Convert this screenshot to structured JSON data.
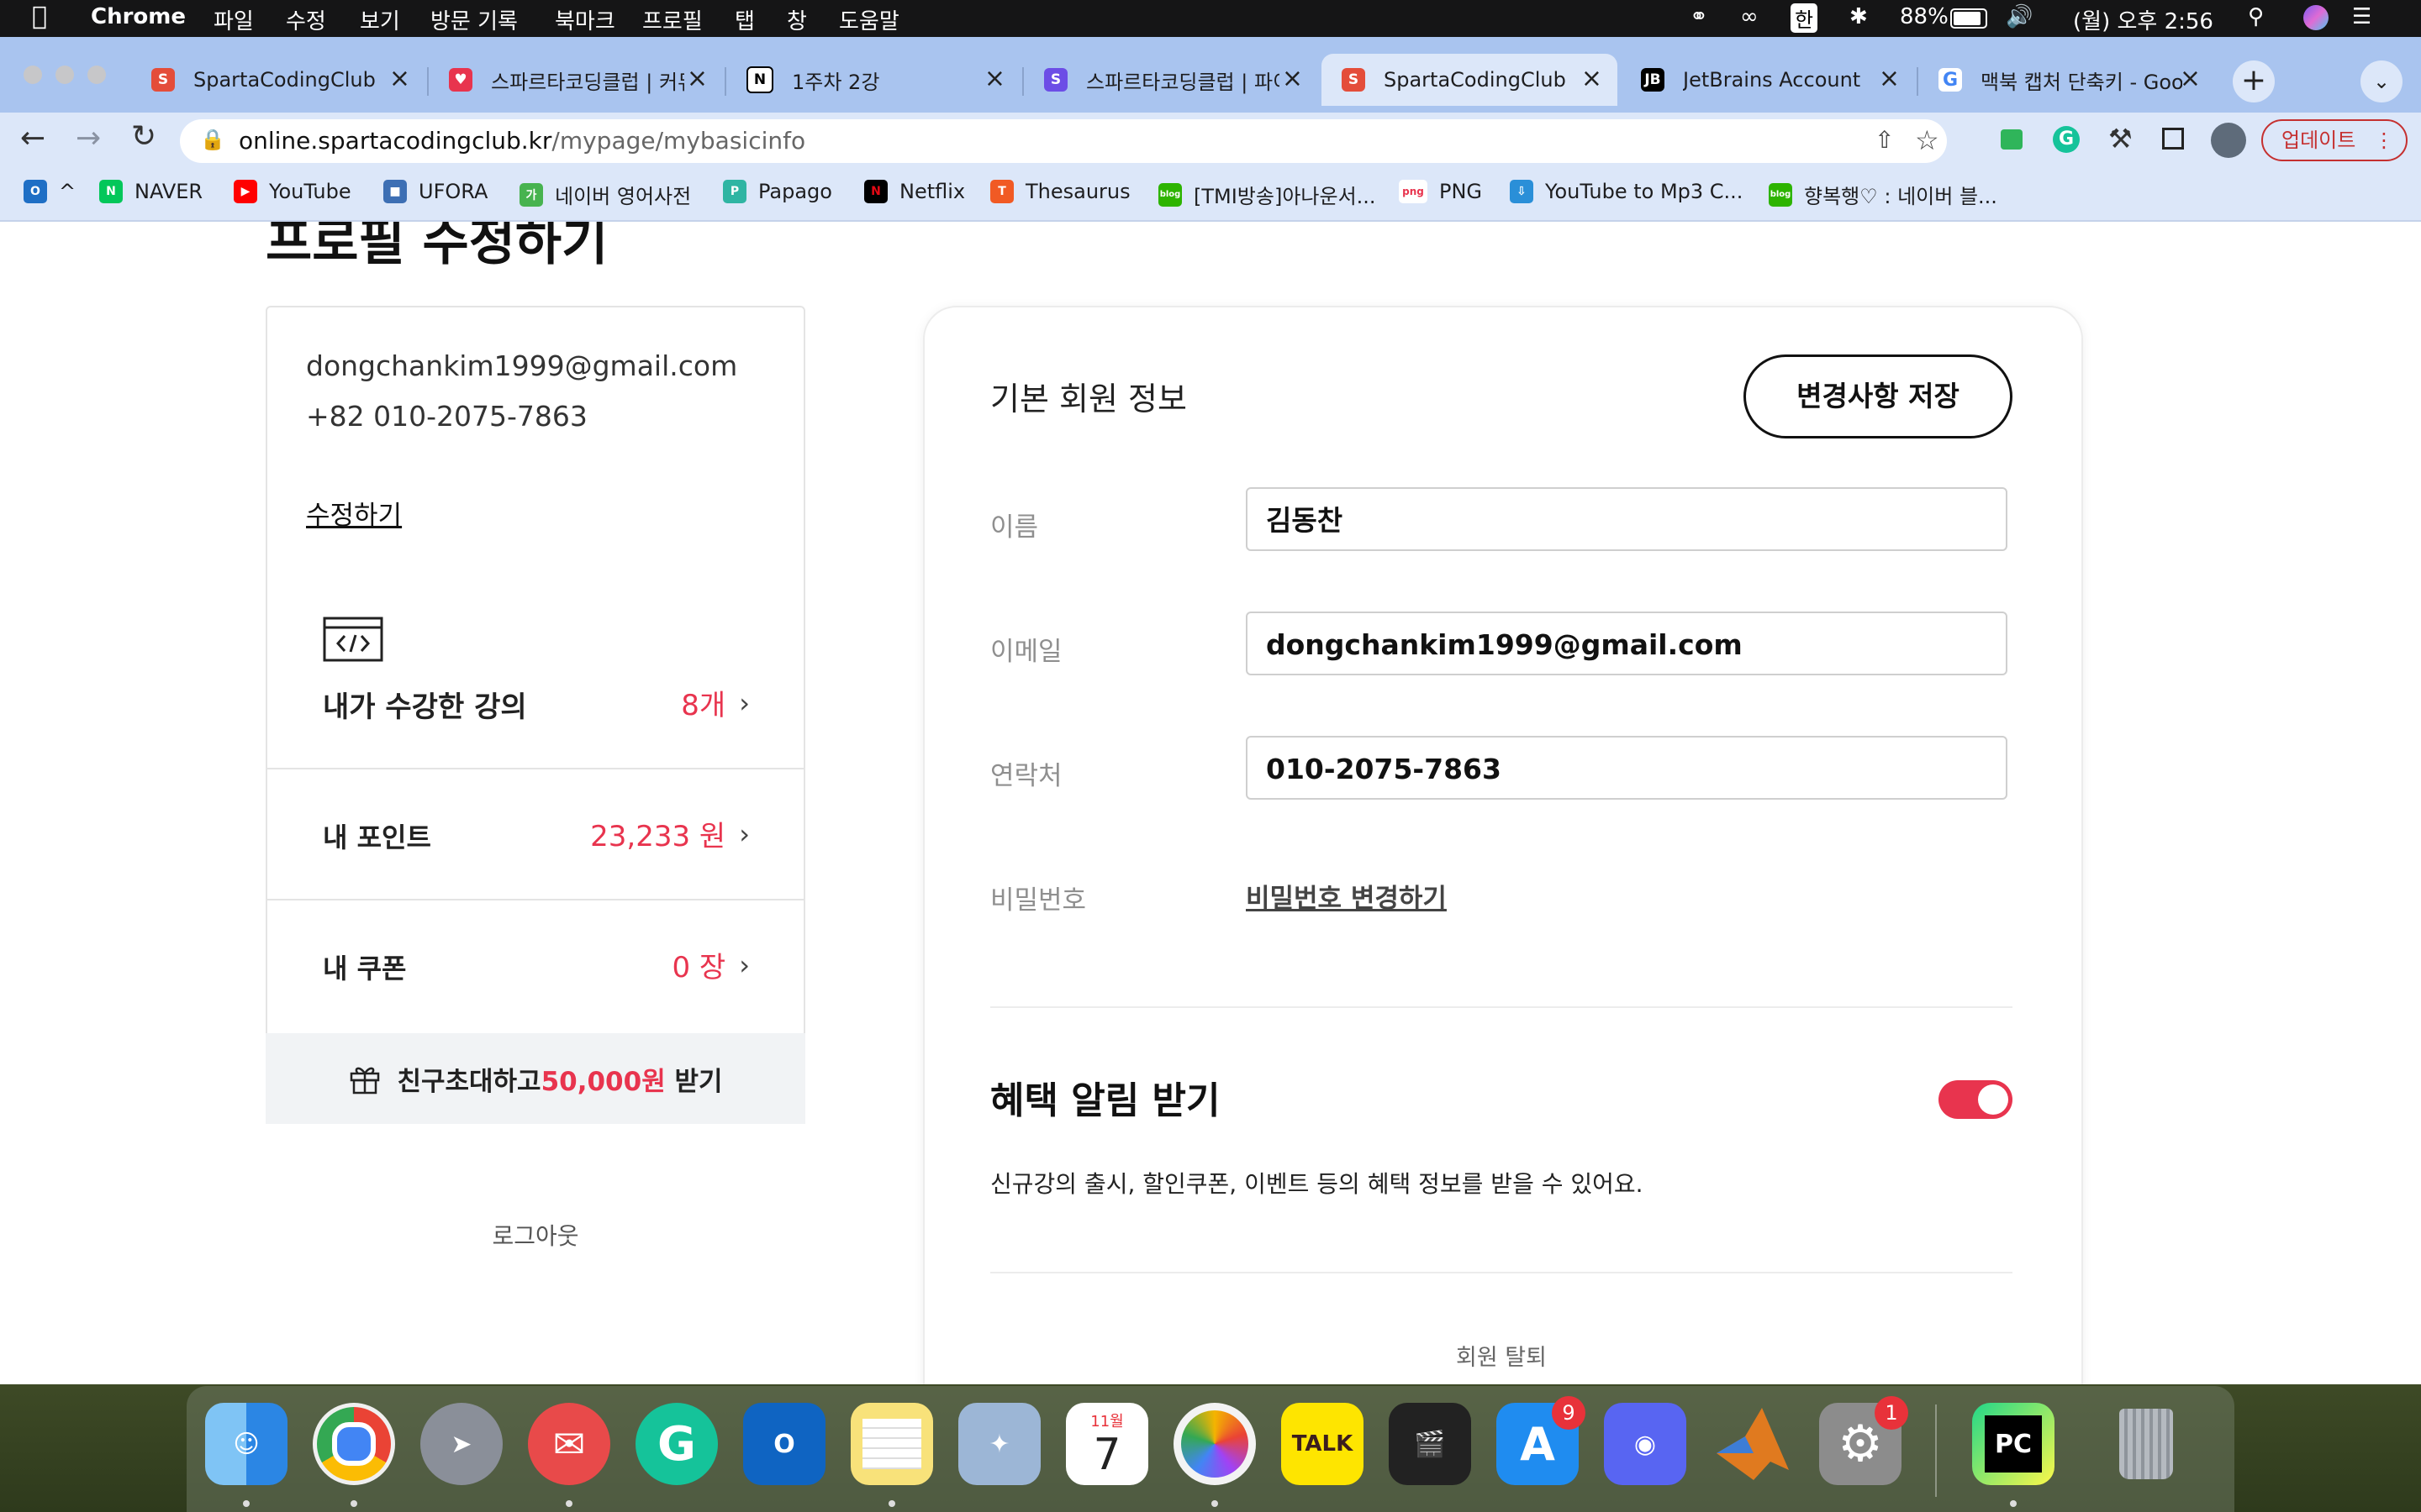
{
  "menubar": {
    "app": "Chrome",
    "menus": [
      "파일",
      "수정",
      "보기",
      "방문 기록",
      "북마크",
      "프로필",
      "탭",
      "창",
      "도움말"
    ],
    "input_source": "한",
    "battery": "88%",
    "clock": "(월) 오후 2:56"
  },
  "tabs": [
    {
      "title": "SpartaCodingClub",
      "icon": "sparta-favicon",
      "color": "#e44d3a"
    },
    {
      "title": "스파르타코딩클럽 | 커뮤",
      "icon": "heart-code-favicon",
      "color": "#e8344e"
    },
    {
      "title": "1주차 2강",
      "icon": "notion-favicon",
      "color": "#000000"
    },
    {
      "title": "스파르타코딩클럽 | 파이",
      "icon": "sparta-blue-favicon",
      "color": "#6c4de6"
    },
    {
      "title": "SpartaCodingClub",
      "icon": "sparta-favicon",
      "color": "#e44d3a"
    },
    {
      "title": "JetBrains Account",
      "icon": "jetbrains-favicon",
      "color": "#000000"
    },
    {
      "title": "맥북 캡처 단축키 - Goo",
      "icon": "google-favicon",
      "color": "#4285f4"
    }
  ],
  "address": {
    "host": "online.spartacodingclub.kr",
    "path": "/mypage/mybasicinfo"
  },
  "toolbar": {
    "update_label": "업데이트"
  },
  "bookmarks": [
    {
      "label": "^",
      "icon": "outlook-icon",
      "color": "#1f6fc5"
    },
    {
      "label": "NAVER",
      "icon": "naver-icon",
      "color": "#03c75a"
    },
    {
      "label": "YouTube",
      "icon": "youtube-icon",
      "color": "#ff0000"
    },
    {
      "label": "UFORA",
      "icon": "ufora-icon",
      "color": "#3d6fb4"
    },
    {
      "label": "네이버 영어사전",
      "icon": "naver-dict-icon",
      "color": "#47b34f"
    },
    {
      "label": "Papago",
      "icon": "papago-icon",
      "color": "#2fb5a3"
    },
    {
      "label": "Netflix",
      "icon": "netflix-icon",
      "color": "#e50914"
    },
    {
      "label": "Thesaurus",
      "icon": "thesaurus-icon",
      "color": "#f15a24"
    },
    {
      "label": "[TMI방송]아나운서...",
      "icon": "blog-icon",
      "color": "#2db400"
    },
    {
      "label": "PNG",
      "icon": "png-icon",
      "color": "#e8344e"
    },
    {
      "label": "YouTube to Mp3 C...",
      "icon": "cloud-download-icon",
      "color": "#2a8fd8"
    },
    {
      "label": "향복행♡ : 네이버 블...",
      "icon": "blog-icon",
      "color": "#2db400"
    }
  ],
  "page": {
    "heading": "프로필 수정하기",
    "summary": {
      "email": "dongchankim1999@gmail.com",
      "phone": "+82 010-2075-7863",
      "edit_link": "수정하기"
    },
    "menu": [
      {
        "label": "내가 수강한 강의",
        "value": "8개"
      },
      {
        "label": "내 포인트",
        "value": "23,233 원"
      },
      {
        "label": "내 쿠폰",
        "value": "0 장"
      }
    ],
    "invite": {
      "prefix": "친구초대하고 ",
      "amount": "50,000원",
      "suffix": " 받기"
    },
    "logout": "로그아웃",
    "basic": {
      "title": "기본 회원 정보",
      "save": "변경사항 저장",
      "name_label": "이름",
      "name_value": "김동찬",
      "email_label": "이메일",
      "email_value": "dongchankim1999@gmail.com",
      "phone_label": "연락처",
      "phone_value": "010-2075-7863",
      "password_label": "비밀번호",
      "password_link": "비밀번호 변경하기"
    },
    "benefit": {
      "title": "혜택 알림 받기",
      "desc": "신규강의 출시, 할인쿠폰, 이벤트 등의 혜택 정보를 받을 수 있어요.",
      "enabled": true
    },
    "withdraw": "회원 탈퇴",
    "accent_color": "#e8344e"
  },
  "dock": {
    "apps": [
      {
        "name": "finder-icon",
        "color": "#3aa0f0"
      },
      {
        "name": "chrome-icon",
        "color": "#e9e9e9"
      },
      {
        "name": "launchpad-icon",
        "color": "#8a8f99"
      },
      {
        "name": "mail-icon",
        "color": "#e84a4a"
      },
      {
        "name": "grammarly-icon",
        "color": "#15c39a"
      },
      {
        "name": "outlook-icon",
        "color": "#0f64c2"
      },
      {
        "name": "notes-icon",
        "color": "#f8e27a"
      },
      {
        "name": "mail-eagle-icon",
        "color": "#9cb6d6"
      },
      {
        "name": "calendar-icon",
        "color": "#ffffff"
      },
      {
        "name": "photos-icon",
        "color": "#f3f3f3"
      },
      {
        "name": "kakaotalk-icon",
        "color": "#fee500"
      },
      {
        "name": "final-cut-icon",
        "color": "#222222"
      },
      {
        "name": "app-store-icon",
        "color": "#1f8cf0"
      },
      {
        "name": "discord-icon",
        "color": "#5865f2"
      },
      {
        "name": "matlab-icon",
        "color": "#e07a1f"
      },
      {
        "name": "system-preferences-icon",
        "color": "#8c8c8c"
      },
      {
        "name": "pycharm-icon",
        "color": "#21d789"
      },
      {
        "name": "trash-icon",
        "color": "#9aa0a6"
      }
    ],
    "calendar_month": "11월",
    "calendar_day": "7",
    "kakao_label": "TALK",
    "pycharm_label": "PC",
    "badges": {
      "app_store": "9",
      "system_preferences": "1"
    }
  }
}
